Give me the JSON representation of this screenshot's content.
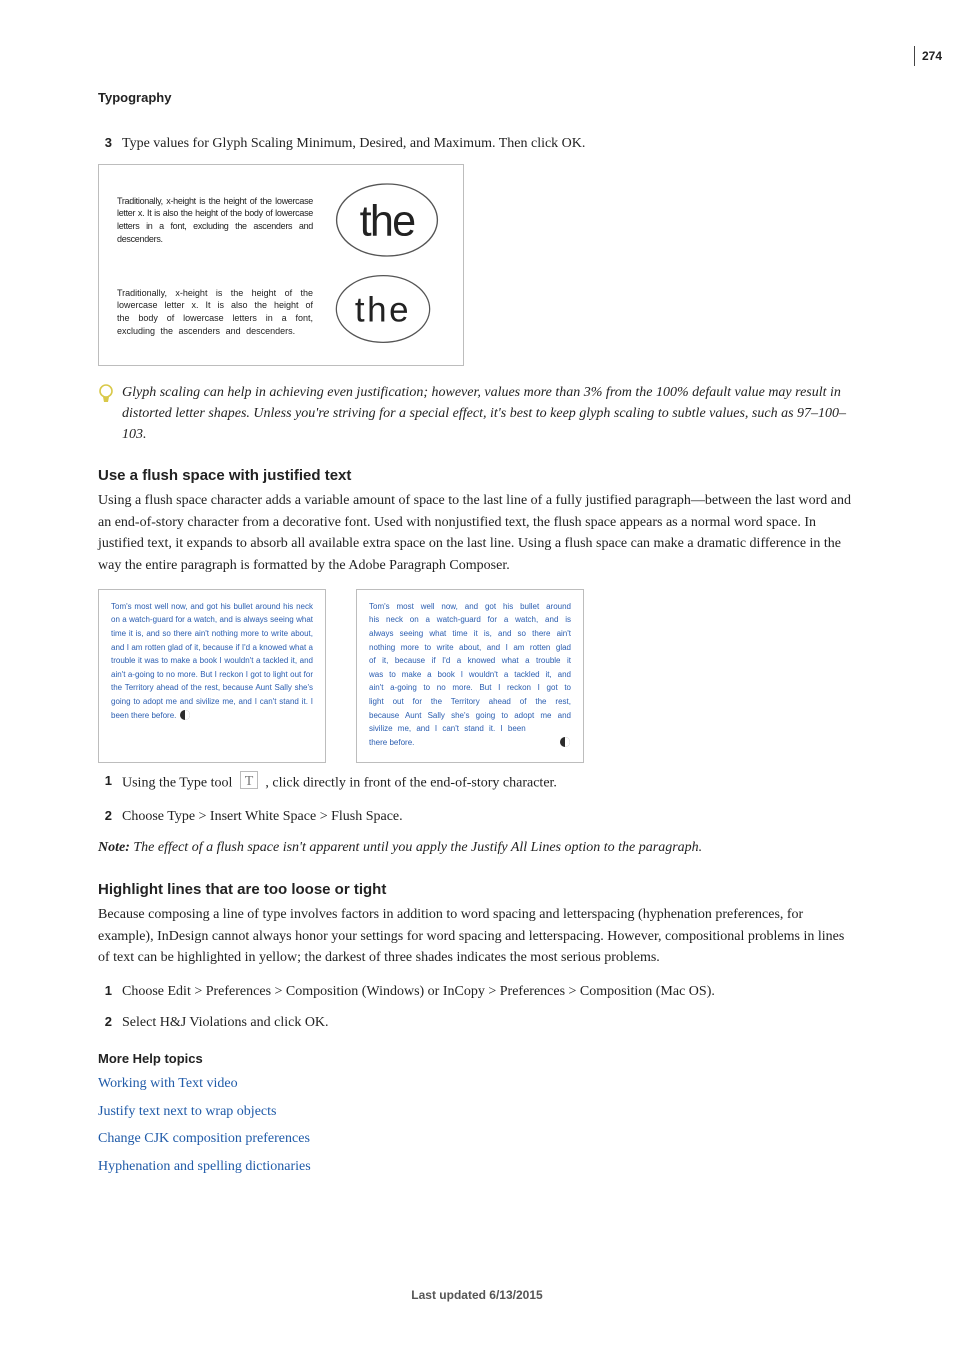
{
  "page_number": "274",
  "section": "Typography",
  "step3": {
    "num": "3",
    "text": "Type values for Glyph Scaling Minimum, Desired, and Maximum. Then click OK."
  },
  "figure_glyph": {
    "tight": "Traditionally, x-height is the height of the lowercase letter x. It is also the height of the body of lowercase letters in a font, excluding the ascenders and descenders.",
    "loose": "Traditionally, x-height is the height of the lowercase letter x. It is also the height of the body of lowercase letters in a font, excluding the ascenders and descenders."
  },
  "tip_text": "Glyph scaling can help in achieving even justification; however, values more than 3% from the 100% default value may result in distorted letter shapes. Unless you're striving for a special effect, it's best to keep glyph scaling to subtle values, such as 97–100–103.",
  "flush": {
    "heading": "Use a flush space with justified text",
    "para": "Using a flush space character adds a variable amount of space to the last line of a fully justified paragraph—between the last word and an end-of-story character from a decorative font. Used with nonjustified text, the flush space appears as a normal word space. In justified text, it expands to absorb all available extra space on the last line. Using a flush space can make a dramatic difference in the way the entire paragraph is formatted by the Adobe Paragraph Composer.",
    "mini_left": "Tom's most well now, and got his bullet around his neck on a watch-guard for a watch, and is always seeing what time it is, and so there ain't nothing more to write about, and I am rotten glad of it, because if I'd a knowed what a trouble it was to make a book I wouldn't a tackled it, and ain't a-going to no more. But I reckon I got to light out for the Territory ahead of the rest, because Aunt Sally she's going to adopt me and sivilize me, and I can't stand it. I been there before. ",
    "mini_right_main": "Tom's most well now, and got his bullet around his neck on a watch-guard for a watch, and is always seeing what time it is, and so there ain't nothing more to write about, and I am rotten glad of it, because if I'd a knowed what a trouble it was to make a book I wouldn't a tackled it, and ain't a-going to no more. But I reckon I got to light out for the Territory ahead of the rest, because Aunt Sally she's going to adopt me and sivilize me, and I can't stand it. I been",
    "mini_right_last": "there before.",
    "step1_num": "1",
    "step1_a": "Using the Type tool ",
    "step1_b": " , click directly in front of the end-of-story character.",
    "step2_num": "2",
    "step2_text": "Choose Type > Insert White Space > Flush Space.",
    "note_label": "Note:",
    "note_text": " The effect of a flush space isn't apparent until you apply the Justify All Lines option to the paragraph."
  },
  "highlight": {
    "heading": "Highlight lines that are too loose or tight",
    "para": "Because composing a line of type involves factors in addition to word spacing and letterspacing (hyphenation preferences, for example), InDesign cannot always honor your settings for word spacing and letterspacing. However, compositional problems in lines of text can be highlighted in yellow; the darkest of three shades indicates the most serious problems.",
    "step1_num": "1",
    "step1_text": "Choose Edit > Preferences > Composition (Windows) or InCopy > Preferences > Composition (Mac OS).",
    "step2_num": "2",
    "step2_text": "Select H&J Violations and click OK."
  },
  "more_help_heading": "More Help topics",
  "links": {
    "l1": "Working with Text video",
    "l2": "Justify text next to wrap objects",
    "l3": "Change CJK composition preferences",
    "l4": "Hyphenation and spelling dictionaries"
  },
  "footer": "Last updated 6/13/2015"
}
